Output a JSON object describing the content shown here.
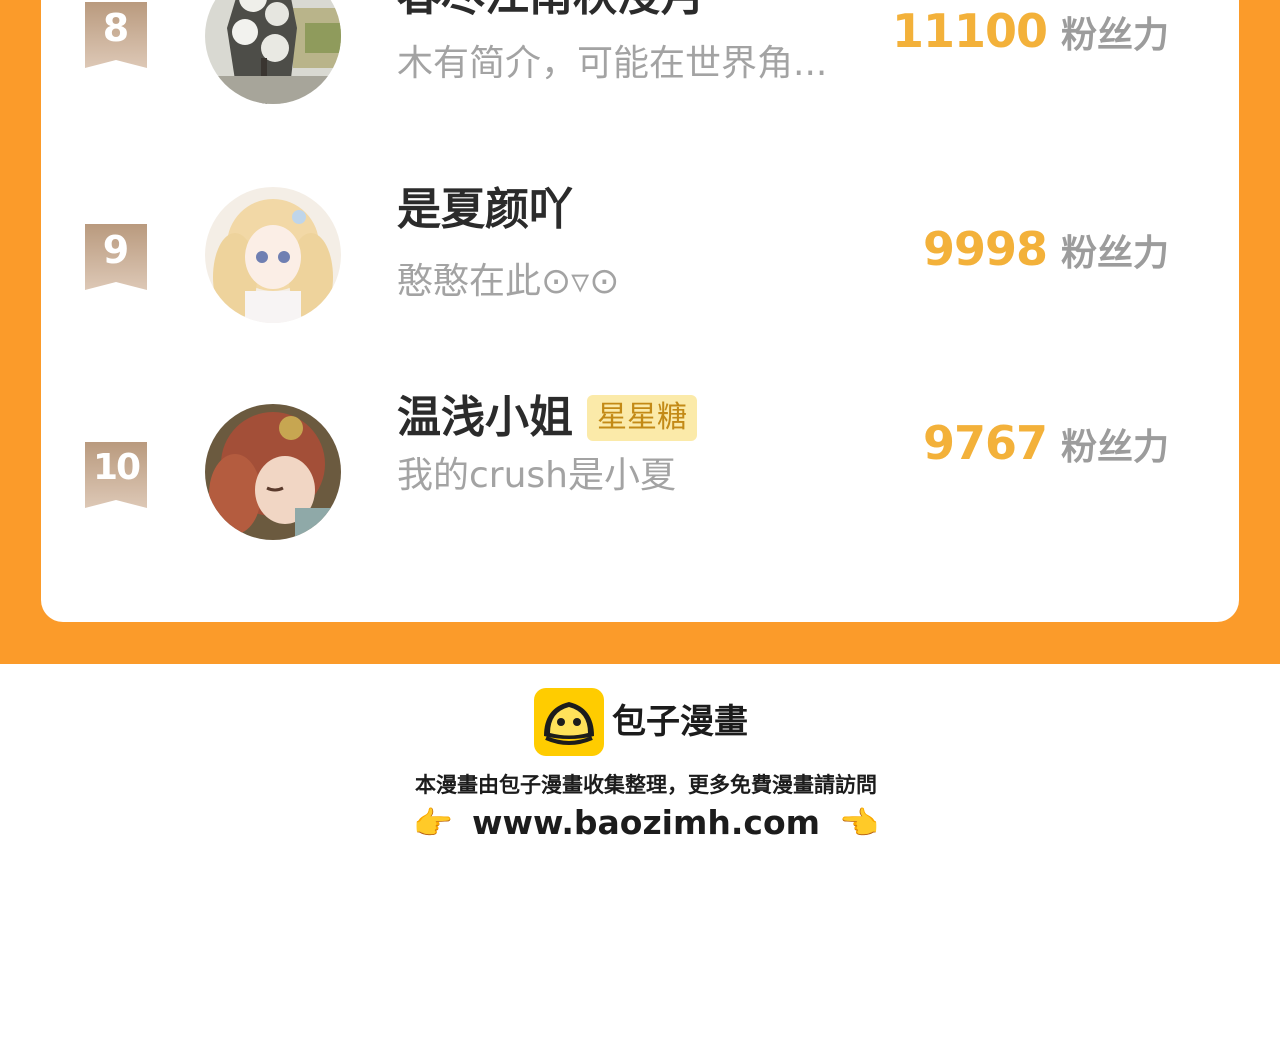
{
  "ranking": {
    "score_unit": "粉丝力",
    "entries": [
      {
        "rank": "8",
        "name": "春尽江南秋浸月",
        "tag": "",
        "bio": "木有简介，可能在世界角...",
        "score": "11100",
        "avatar_icon": "winter-tree-avatar"
      },
      {
        "rank": "9",
        "name": "是夏颜吖",
        "tag": "",
        "bio": "憨憨在此⊙▿⊙",
        "score": "9998",
        "avatar_icon": "anime-girl-blonde-avatar"
      },
      {
        "rank": "10",
        "name": "温浅小姐",
        "tag": "星星糖",
        "bio": "我的crush是小夏",
        "score": "9767",
        "avatar_icon": "anime-girl-redhair-avatar"
      }
    ]
  },
  "footer": {
    "brand": "包子漫畫",
    "note": "本漫畫由包子漫畫收集整理，更多免費漫畫請訪問",
    "url": "www.baozimh.com",
    "left_hand": "👉",
    "right_hand": "👈"
  },
  "colors": {
    "background_orange": "#fb9b2a",
    "score_orange": "#f3b13a",
    "tag_bg": "#fbeaa9",
    "badge_tan": "#c9ad95"
  }
}
